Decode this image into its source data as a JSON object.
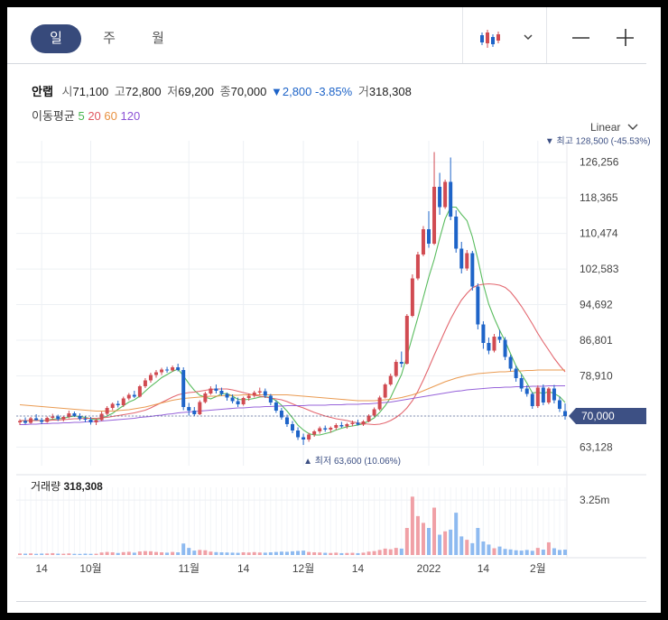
{
  "toolbar": {
    "tabs": [
      "일",
      "주",
      "월"
    ],
    "selected": "일"
  },
  "summary": {
    "name": "안랩",
    "open_label": "시",
    "open": "71,100",
    "high_label": "고",
    "high": "72,800",
    "low_label": "저",
    "low": "69,200",
    "close_label": "종",
    "close": "70,000",
    "change": "▼2,800",
    "change_pct": "-3.85%",
    "volume_label": "거",
    "volume": "318,308"
  },
  "ma_legend": {
    "label": "이동평균",
    "items": [
      {
        "period": "5",
        "color": "#47b54d"
      },
      {
        "period": "20",
        "color": "#e0575f"
      },
      {
        "period": "60",
        "color": "#e8903f"
      },
      {
        "period": "120",
        "color": "#8c52d6"
      }
    ]
  },
  "scale": {
    "label": "Linear"
  },
  "colors": {
    "up": "#d14b52",
    "down": "#1e64c8",
    "vol_up": "#f0a0a6",
    "vol_down": "#8ebaf0",
    "grid": "#edf0f4",
    "badge": "#3d5084"
  },
  "chart_data": {
    "type": "candlestick",
    "ylim": [
      59000,
      131000
    ],
    "y_ticks": [
      63128,
      70000,
      78910,
      86801,
      94692,
      102583,
      110474,
      118365,
      126256
    ],
    "y_tick_labels": [
      "63,128",
      "",
      "78,910",
      "86,801",
      "94,692",
      "102,583",
      "110,474",
      "118,365",
      "126,256"
    ],
    "current_price": {
      "value": 70000,
      "label": "70,000"
    },
    "max_annotation": {
      "value": 128500,
      "index": 97,
      "label": "▼ 최고 128,500 (-45.53%)"
    },
    "min_annotation": {
      "value": 63600,
      "index": 53,
      "label": "▲ 최저 63,600 (10.06%)"
    },
    "x_ticks": [
      {
        "index": 4,
        "label": "14"
      },
      {
        "index": 13,
        "label": "10월"
      },
      {
        "index": 31,
        "label": "11월"
      },
      {
        "index": 41,
        "label": "14"
      },
      {
        "index": 52,
        "label": "12월"
      },
      {
        "index": 62,
        "label": "14"
      },
      {
        "index": 75,
        "label": "2022"
      },
      {
        "index": 85,
        "label": "14"
      },
      {
        "index": 95,
        "label": "2월"
      }
    ],
    "candles": [
      [
        68600,
        69300,
        68000,
        68900
      ],
      [
        68900,
        69700,
        68200,
        68500
      ],
      [
        68500,
        69800,
        68300,
        69500
      ],
      [
        69500,
        70400,
        69000,
        69100
      ],
      [
        69100,
        69600,
        68200,
        68700
      ],
      [
        68700,
        69900,
        68500,
        69600
      ],
      [
        69600,
        70500,
        69200,
        69900
      ],
      [
        69900,
        70300,
        68900,
        69300
      ],
      [
        69300,
        70100,
        68800,
        69800
      ],
      [
        69800,
        71200,
        69500,
        70600
      ],
      [
        70600,
        71000,
        69800,
        70000
      ],
      [
        70000,
        70600,
        69000,
        69400
      ],
      [
        69400,
        70000,
        68600,
        69200
      ],
      [
        69200,
        69800,
        68100,
        68600
      ],
      [
        68600,
        69400,
        68000,
        69100
      ],
      [
        69100,
        71000,
        68900,
        70500
      ],
      [
        70500,
        72200,
        70200,
        71800
      ],
      [
        71800,
        73000,
        71300,
        72700
      ],
      [
        72700,
        73400,
        71900,
        72400
      ],
      [
        72400,
        74300,
        72000,
        73900
      ],
      [
        73900,
        75100,
        73500,
        74700
      ],
      [
        74700,
        75600,
        74000,
        74300
      ],
      [
        74300,
        76900,
        74100,
        76600
      ],
      [
        76600,
        78400,
        76200,
        77900
      ],
      [
        77900,
        79600,
        77400,
        79100
      ],
      [
        79100,
        80200,
        78500,
        79700
      ],
      [
        79700,
        80700,
        79100,
        80300
      ],
      [
        80300,
        80900,
        79600,
        80100
      ],
      [
        80100,
        81200,
        79800,
        80800
      ],
      [
        80800,
        81600,
        79900,
        80200
      ],
      [
        80200,
        80800,
        71300,
        72000
      ],
      [
        72000,
        72900,
        70100,
        71200
      ],
      [
        71200,
        72000,
        70000,
        70400
      ],
      [
        70400,
        73500,
        70200,
        73100
      ],
      [
        73100,
        75400,
        72800,
        75000
      ],
      [
        75000,
        76600,
        74700,
        76100
      ],
      [
        76100,
        77000,
        75000,
        75600
      ],
      [
        75600,
        76300,
        74500,
        74900
      ],
      [
        74900,
        75200,
        73400,
        74100
      ],
      [
        74100,
        74800,
        72800,
        73300
      ],
      [
        73300,
        74100,
        72000,
        72600
      ],
      [
        72600,
        74300,
        72300,
        74000
      ],
      [
        74000,
        75000,
        73400,
        74500
      ],
      [
        74500,
        75600,
        74100,
        75200
      ],
      [
        75200,
        76300,
        74700,
        75500
      ],
      [
        75500,
        76100,
        74000,
        74500
      ],
      [
        74500,
        74900,
        72400,
        73000
      ],
      [
        73000,
        73500,
        70700,
        71200
      ],
      [
        71200,
        71800,
        69200,
        69700
      ],
      [
        69700,
        70300,
        67600,
        68200
      ],
      [
        68200,
        68900,
        66200,
        66800
      ],
      [
        66800,
        67500,
        64700,
        65300
      ],
      [
        65300,
        66100,
        63600,
        64800
      ],
      [
        64800,
        66300,
        64300,
        65900
      ],
      [
        65900,
        66900,
        65400,
        66600
      ],
      [
        66600,
        67700,
        66100,
        67300
      ],
      [
        67300,
        67900,
        66500,
        67000
      ],
      [
        67000,
        67700,
        66300,
        67400
      ],
      [
        67400,
        68400,
        66900,
        68000
      ],
      [
        68000,
        68700,
        67400,
        67700
      ],
      [
        67700,
        68500,
        67200,
        68200
      ],
      [
        68200,
        69000,
        67700,
        68500
      ],
      [
        68500,
        69200,
        67900,
        68100
      ],
      [
        68100,
        69100,
        67800,
        68800
      ],
      [
        68800,
        70400,
        68600,
        70100
      ],
      [
        70100,
        71900,
        69800,
        71500
      ],
      [
        71500,
        74500,
        71200,
        74100
      ],
      [
        74100,
        77300,
        73900,
        77000
      ],
      [
        77000,
        79400,
        76700,
        78900
      ],
      [
        78900,
        82500,
        78600,
        82000
      ],
      [
        82000,
        84300,
        80800,
        81600
      ],
      [
        81600,
        92600,
        81400,
        92200
      ],
      [
        92200,
        101400,
        91900,
        100500
      ],
      [
        100500,
        106400,
        100100,
        105800
      ],
      [
        105800,
        112100,
        105400,
        111400
      ],
      [
        111400,
        115400,
        107300,
        108200
      ],
      [
        108200,
        128500,
        107900,
        120800
      ],
      [
        120800,
        123900,
        114600,
        116300
      ],
      [
        116300,
        122400,
        115900,
        121900
      ],
      [
        121900,
        127300,
        113400,
        114200
      ],
      [
        114200,
        115600,
        106200,
        107100
      ],
      [
        107100,
        108600,
        101600,
        102700
      ],
      [
        102700,
        106800,
        102200,
        106100
      ],
      [
        106100,
        106600,
        97800,
        98700
      ],
      [
        98700,
        99400,
        89200,
        90300
      ],
      [
        90300,
        91000,
        84900,
        86200
      ],
      [
        86200,
        87400,
        83700,
        84500
      ],
      [
        84500,
        88200,
        84100,
        87600
      ],
      [
        87600,
        89100,
        86200,
        86900
      ],
      [
        86900,
        87500,
        82400,
        83100
      ],
      [
        83100,
        83600,
        79900,
        80500
      ],
      [
        80500,
        81200,
        77600,
        78400
      ],
      [
        78400,
        79200,
        75400,
        76100
      ],
      [
        76100,
        76800,
        74300,
        74900
      ],
      [
        74900,
        75300,
        71600,
        72200
      ],
      [
        72200,
        76800,
        71800,
        76300
      ],
      [
        76300,
        77000,
        72400,
        73000
      ],
      [
        73000,
        76400,
        72600,
        76100
      ],
      [
        76100,
        76900,
        72800,
        73500
      ],
      [
        73500,
        74300,
        70900,
        71600
      ],
      [
        71100,
        72800,
        69200,
        70000
      ]
    ],
    "ma": {
      "5": [
        69000,
        68900,
        69000,
        69100,
        69000,
        69100,
        69300,
        69400,
        69500,
        69800,
        70000,
        69900,
        69700,
        69400,
        69200,
        69500,
        70000,
        70600,
        71500,
        72300,
        73100,
        73600,
        74400,
        75500,
        76600,
        77500,
        78500,
        79200,
        79900,
        80400,
        78900,
        77200,
        75700,
        74600,
        74200,
        73800,
        74300,
        74900,
        75000,
        74400,
        73700,
        73600,
        73700,
        73900,
        74200,
        74300,
        74100,
        73400,
        72400,
        71100,
        69600,
        68000,
        66900,
        66100,
        65800,
        65800,
        66100,
        66400,
        66900,
        67300,
        67600,
        67800,
        68000,
        68300,
        68900,
        69600,
        70800,
        72300,
        74100,
        76700,
        79200,
        83300,
        87600,
        91800,
        96300,
        100800,
        104700,
        109400,
        113700,
        116300,
        116300,
        114700,
        113300,
        109700,
        104700,
        99200,
        94800,
        91700,
        89000,
        86600,
        83800,
        81100,
        79300,
        77300,
        75100,
        75300,
        75000,
        75400,
        75000,
        74300,
        73000
      ],
      "20": [
        69000,
        69000,
        69000,
        69000,
        69000,
        69000,
        69100,
        69100,
        69200,
        69300,
        69400,
        69400,
        69500,
        69500,
        69500,
        69600,
        69700,
        69900,
        70100,
        70300,
        70500,
        70700,
        71000,
        71300,
        71800,
        72400,
        73000,
        73600,
        74200,
        74700,
        75000,
        75200,
        75300,
        75500,
        75700,
        75900,
        76000,
        76000,
        76000,
        75800,
        75500,
        75200,
        74900,
        74600,
        74400,
        74200,
        74000,
        73800,
        73600,
        73200,
        72700,
        72200,
        71800,
        71300,
        70800,
        70400,
        70000,
        69700,
        69400,
        69200,
        69000,
        68700,
        68500,
        68300,
        68200,
        68100,
        68200,
        68500,
        69000,
        69700,
        70600,
        71800,
        73400,
        75500,
        78000,
        80700,
        83500,
        86200,
        88900,
        91500,
        93700,
        95700,
        97200,
        98400,
        99000,
        99200,
        99300,
        99200,
        99000,
        98500,
        97500,
        96000,
        94300,
        92400,
        90400,
        88300,
        86400,
        84600,
        82800,
        81200,
        79800
      ],
      "60": [
        72500,
        72400,
        72300,
        72200,
        72100,
        72000,
        71900,
        71800,
        71700,
        71600,
        71500,
        71400,
        71300,
        71200,
        71100,
        71100,
        71100,
        71100,
        71200,
        71300,
        71400,
        71600,
        71800,
        72000,
        72300,
        72600,
        72900,
        73200,
        73500,
        73700,
        73900,
        74000,
        74100,
        74200,
        74300,
        74400,
        74400,
        74500,
        74500,
        74600,
        74600,
        74700,
        74700,
        74700,
        74700,
        74700,
        74700,
        74700,
        74700,
        74700,
        74600,
        74500,
        74400,
        74300,
        74200,
        74100,
        74000,
        73900,
        73800,
        73700,
        73600,
        73500,
        73400,
        73400,
        73400,
        73400,
        73500,
        73600,
        73700,
        73900,
        74100,
        74400,
        74700,
        75100,
        75600,
        76100,
        76600,
        77100,
        77600,
        78000,
        78400,
        78700,
        79000,
        79200,
        79400,
        79500,
        79600,
        79700,
        79800,
        79800,
        79900,
        80000,
        80000,
        80100,
        80100,
        80200,
        80200,
        80200,
        80200,
        80200,
        80200
      ],
      "120": [
        68100,
        68100,
        68200,
        68200,
        68300,
        68300,
        68400,
        68400,
        68500,
        68500,
        68600,
        68600,
        68700,
        68800,
        68800,
        68900,
        69000,
        69100,
        69200,
        69300,
        69400,
        69500,
        69700,
        69800,
        69900,
        70100,
        70200,
        70400,
        70500,
        70700,
        70800,
        70900,
        71000,
        71100,
        71200,
        71300,
        71400,
        71500,
        71600,
        71700,
        71800,
        71800,
        71900,
        72000,
        72000,
        72100,
        72100,
        72200,
        72200,
        72300,
        72300,
        72300,
        72300,
        72400,
        72400,
        72400,
        72400,
        72500,
        72500,
        72500,
        72600,
        72600,
        72600,
        72700,
        72700,
        72800,
        72900,
        73000,
        73100,
        73300,
        73500,
        73700,
        73900,
        74100,
        74300,
        74500,
        74700,
        74900,
        75100,
        75300,
        75500,
        75600,
        75800,
        75900,
        76000,
        76100,
        76200,
        76300,
        76300,
        76400,
        76400,
        76500,
        76500,
        76500,
        76600,
        76600,
        76600,
        76700,
        76700,
        76700,
        76700
      ]
    },
    "volume": {
      "label": "거래량",
      "last_value": "318,308",
      "y_tick": 3250000,
      "y_tick_label": "3.25m",
      "ylim": [
        0,
        4000000
      ],
      "values": [
        90000,
        80000,
        95000,
        70000,
        85000,
        90000,
        110000,
        80000,
        75000,
        95000,
        70000,
        65000,
        80000,
        70000,
        75000,
        150000,
        180000,
        160000,
        120000,
        170000,
        190000,
        140000,
        210000,
        230000,
        220000,
        180000,
        160000,
        140000,
        180000,
        160000,
        680000,
        420000,
        260000,
        300000,
        280000,
        200000,
        170000,
        160000,
        150000,
        140000,
        130000,
        160000,
        150000,
        170000,
        150000,
        140000,
        160000,
        180000,
        200000,
        190000,
        220000,
        240000,
        260000,
        180000,
        160000,
        150000,
        130000,
        120000,
        140000,
        110000,
        120000,
        130000,
        110000,
        140000,
        200000,
        230000,
        300000,
        380000,
        340000,
        420000,
        380000,
        1600000,
        3450000,
        2300000,
        1900000,
        1600000,
        2800000,
        1200000,
        1400000,
        1500000,
        2500000,
        1100000,
        900000,
        700000,
        1600000,
        800000,
        620000,
        400000,
        500000,
        360000,
        330000,
        280000,
        260000,
        300000,
        250000,
        420000,
        320000,
        750000,
        400000,
        300000,
        318308
      ]
    }
  }
}
